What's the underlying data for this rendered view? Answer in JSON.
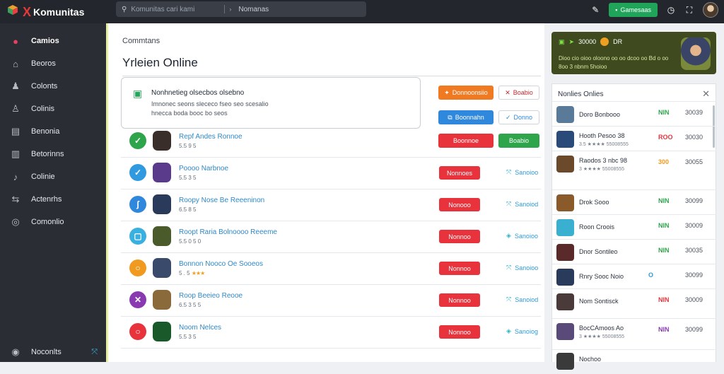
{
  "app": {
    "brand_x": "X",
    "brand_name": "Komunitas"
  },
  "search": {
    "placeholder": "Komunitas cari kami",
    "second": "Nomanas"
  },
  "topbar": {
    "button_label": "Gamesaas"
  },
  "sidebar": {
    "items": [
      {
        "label": "Camios",
        "icon": "gamepad-icon",
        "glyph": "●"
      },
      {
        "label": "Beoros",
        "icon": "controller-icon",
        "glyph": "⌂"
      },
      {
        "label": "Colonts",
        "icon": "users-icon",
        "glyph": "♟"
      },
      {
        "label": "Colinis",
        "icon": "user-icon",
        "glyph": "♙"
      },
      {
        "label": "Benonia",
        "icon": "list-icon",
        "glyph": "▤"
      },
      {
        "label": "Betorinns",
        "icon": "table-icon",
        "glyph": "▥"
      },
      {
        "label": "Colinie",
        "icon": "music-icon",
        "glyph": "♪"
      },
      {
        "label": "Actenrhs",
        "icon": "chart-icon",
        "glyph": "⇆"
      },
      {
        "label": "Comonlio",
        "icon": "globe-icon",
        "glyph": "◎"
      }
    ],
    "bottom": {
      "label": "Noconlts",
      "icon": "shield-icon",
      "glyph": "◉",
      "ext_glyph": "⤧"
    }
  },
  "main": {
    "breadcrumb": "Commtans",
    "title": "Yrleien Online",
    "notice": {
      "title": "Nonhnetieg olsecbos olsebno",
      "line1": "Imnonec seons slececo fseo seo scesalio",
      "line2": "hnecca boda booc bo seos"
    },
    "actions": {
      "orange": "Donnoonsiio",
      "outline_red": "Boabio",
      "blue": "Boonnahn",
      "outline_blue": "Donno",
      "red": "Boonnoe",
      "green": "Boabio"
    },
    "rows": [
      {
        "status_color": "#2ea54a",
        "status_glyph": "✓",
        "thumb": "#3a2e2a",
        "name": "Repf Andes Ronnoe",
        "sub": "5.5 9 5",
        "stars": "",
        "button": "",
        "link": ""
      },
      {
        "status_color": "#2f9ae0",
        "status_glyph": "✓",
        "thumb": "#5a3a8a",
        "name": "Poooo Narbnoe",
        "sub": "5.5 3 5",
        "stars": "",
        "button": "Nonnoes",
        "link": "Sanoioo"
      },
      {
        "status_color": "#2f88dc",
        "status_glyph": "ʃ",
        "thumb": "#2a3a5a",
        "name": "Roopy Nose Be Reeeninon",
        "sub": "6.5 8 5",
        "stars": "",
        "button": "Nonooo",
        "link": "Sanoiod"
      },
      {
        "status_color": "#3ab0e0",
        "status_glyph": "▢",
        "thumb": "#4a5a2a",
        "name": "Roopt Raria Bolnoooo Reeeme",
        "sub": "5.5 0 5 0",
        "stars": "",
        "button": "Nonnoo",
        "link": "Sanoioo"
      },
      {
        "status_color": "#f09a20",
        "status_glyph": "○",
        "thumb": "#3a4a6a",
        "name": "Bonnon Nooco Oe Sooeos",
        "sub": "5 . 5",
        "stars": "★★★",
        "button": "Nonnoo",
        "link": "Sanoioo"
      },
      {
        "status_color": "#8a3ab0",
        "status_glyph": "✕",
        "thumb": "#8a6a3a",
        "name": "Roop Beeieo Reooe",
        "sub": "6.5 3 5 5",
        "stars": "",
        "button": "Nonnoo",
        "link": "Sanoiod"
      },
      {
        "status_color": "#e8323c",
        "status_glyph": "○",
        "thumb": "#1a5a2a",
        "name": "Noom Nelces",
        "sub": "5.5 3 5",
        "stars": "",
        "button": "Nonnoo",
        "link": "Sanoiog"
      }
    ]
  },
  "promo": {
    "count": "30000",
    "tag": "DR",
    "text": "Dioo cio oioo oloono oo oo dcoo oo Bd o oo 8oo 3 nbnm 5hoioo"
  },
  "panel": {
    "title": "Nonlies Onlies",
    "close_glyph": "✕",
    "rows": [
      {
        "thumb": "#5a7a9a",
        "name": "Doro Bonbooo",
        "stars": "",
        "stat": "NIN",
        "stat_color": "#2ea54a",
        "num": "30039"
      },
      {
        "thumb": "#2a4a7a",
        "name": "Hooth Pesoo 38",
        "stars": "3.5 ★★★★ 55008555",
        "stat": "ROO",
        "stat_color": "#e8323c",
        "num": "30030"
      },
      {
        "thumb": "#6a4a2a",
        "name": "Raodos 3 nbc 98",
        "stars": "3 ★★★★ 55008555",
        "stat": "300",
        "stat_color": "#f09a20",
        "num": "30055"
      },
      {
        "thumb": "#8a5a2a",
        "name": "Drok Sooo",
        "stars": "",
        "stat": "NIN",
        "stat_color": "#2ea54a",
        "num": "30099"
      },
      {
        "thumb": "#3ab0d0",
        "name": "Roon Croois",
        "stars": "",
        "stat": "NIN",
        "stat_color": "#2ea54a",
        "num": "30009"
      },
      {
        "thumb": "#5a2a2a",
        "name": "Dnor Sontileo",
        "stars": "",
        "stat": "NIN",
        "stat_color": "#2ea54a",
        "num": "30035"
      },
      {
        "thumb": "#2a3a5a",
        "name": "Rnry Sooc Noio",
        "stars": "",
        "stat": "O",
        "stat_color": "#2f9ae0",
        "num": "30099"
      },
      {
        "thumb": "#4a3a3a",
        "name": "Nom Sontisck",
        "stars": "",
        "stat": "NIN",
        "stat_color": "#e8323c",
        "num": "30009"
      },
      {
        "thumb": "#5a4a7a",
        "name": "BocCAmoos Ao",
        "stars": "3 ★★★★ 55008555",
        "stat": "NIN",
        "stat_color": "#8a3ab0",
        "num": "30099"
      },
      {
        "thumb": "#3a3a3a",
        "name": "Nochoo",
        "stars": "",
        "stat": "",
        "stat_color": "#2ea54a",
        "num": ""
      }
    ]
  }
}
